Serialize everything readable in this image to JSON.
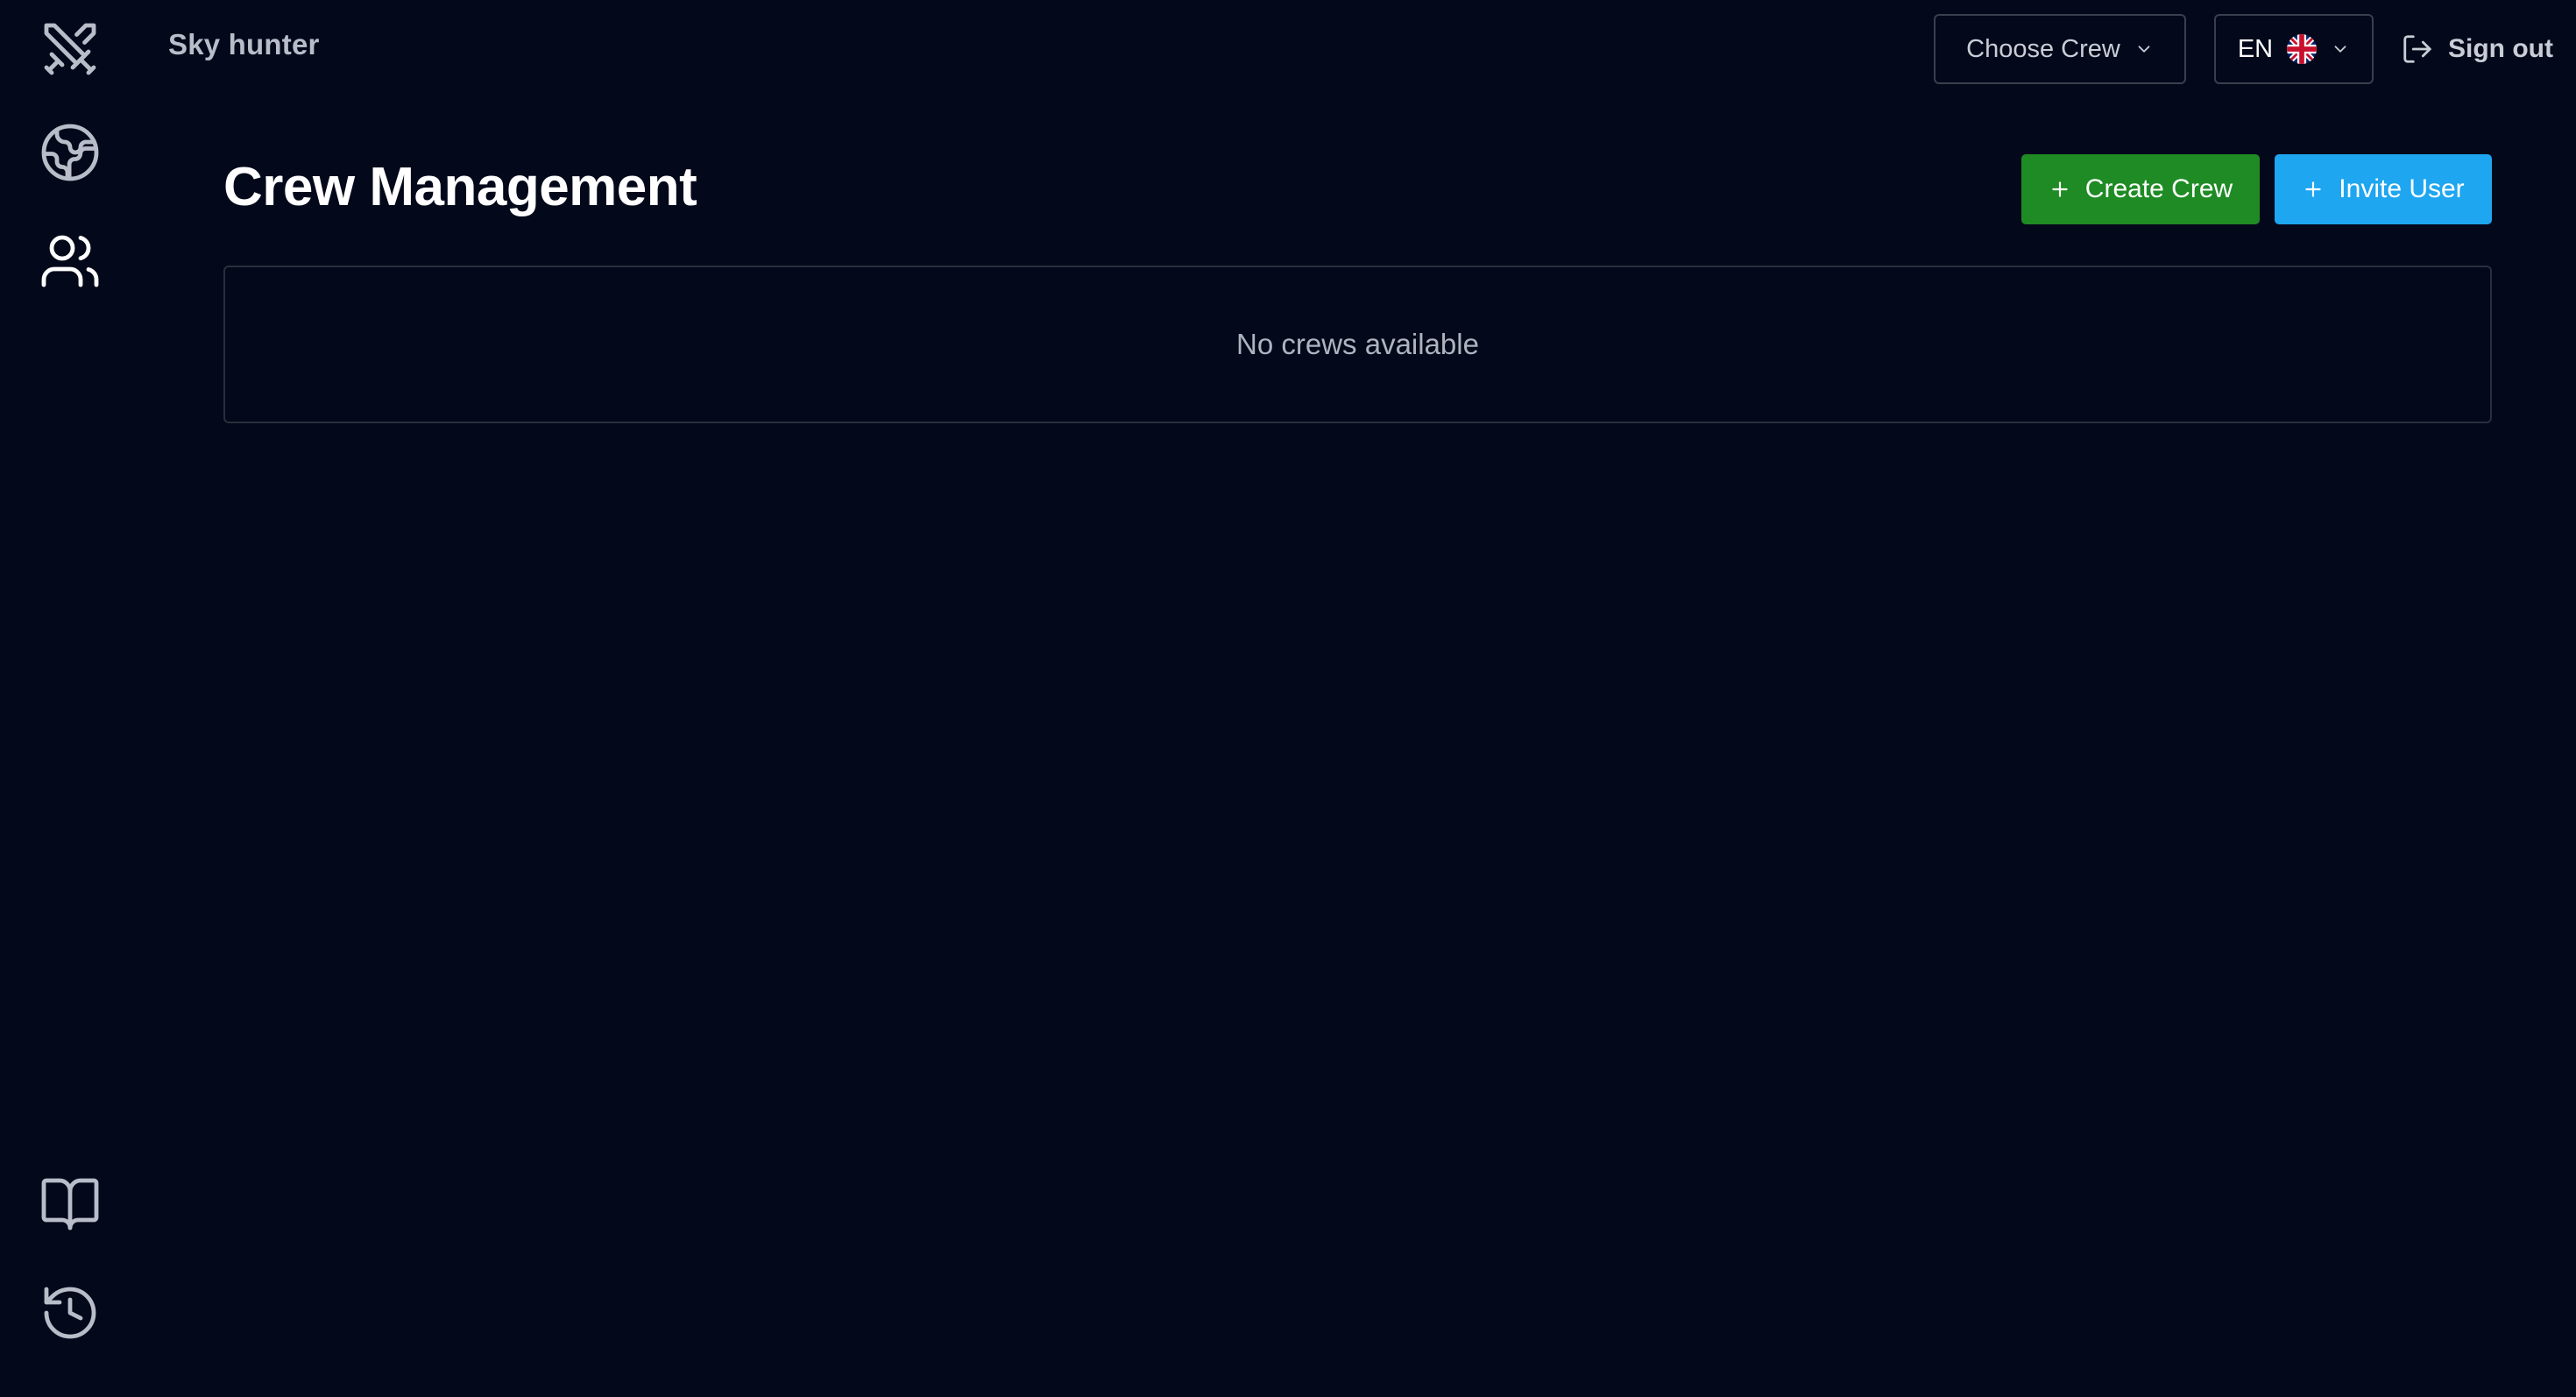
{
  "app": {
    "title": "Sky hunter"
  },
  "header": {
    "crew_select": {
      "label": "Choose Crew"
    },
    "language_select": {
      "label": "EN"
    },
    "signout_label": "Sign out"
  },
  "sidebar": {
    "items": [
      {
        "icon": "crossed-swords-icon"
      },
      {
        "icon": "globe-icon"
      },
      {
        "icon": "users-icon"
      },
      {
        "icon": "book-icon"
      },
      {
        "icon": "history-icon"
      }
    ]
  },
  "main": {
    "title": "Crew Management",
    "actions": {
      "create_label": "Create Crew",
      "invite_label": "Invite User"
    },
    "empty_message": "No crews available"
  },
  "colors": {
    "background": "#03081a",
    "create_button": "#1f8b24",
    "invite_button": "#1ea6f0"
  }
}
